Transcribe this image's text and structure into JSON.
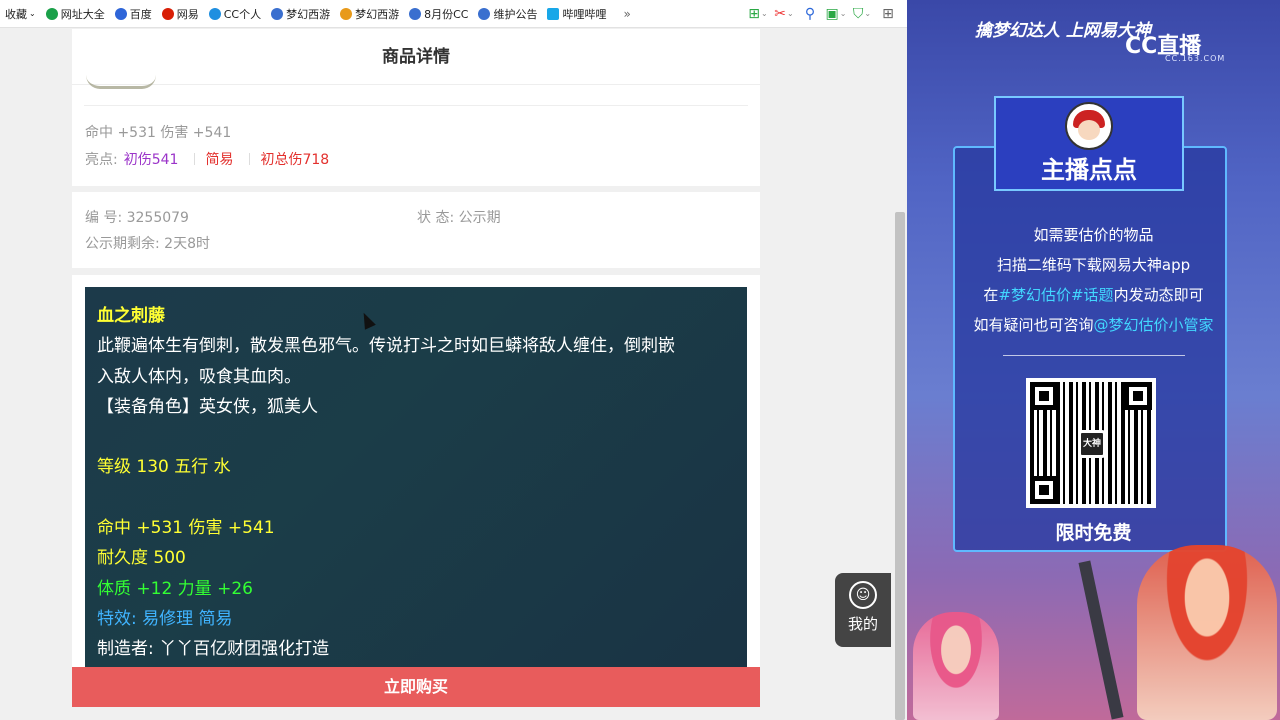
{
  "bookmarks": {
    "items": [
      {
        "label": "收藏",
        "color": "#ffffff"
      },
      {
        "label": "网址大全",
        "color": "#1aa049"
      },
      {
        "label": "百度",
        "color": "#2e65d8"
      },
      {
        "label": "网易",
        "color": "#d81e06"
      },
      {
        "label": "CC个人",
        "color": "#1f8fe0"
      },
      {
        "label": "梦幻西游",
        "color": "#3a6fcf"
      },
      {
        "label": "梦幻西游",
        "color": "#e89a1a"
      },
      {
        "label": "8月份CC",
        "color": "#3a6fcf"
      },
      {
        "label": "维护公告",
        "color": "#3a6fcf"
      },
      {
        "label": "哔哩哔哩",
        "color": "#18a7e8"
      }
    ],
    "more": "»"
  },
  "page": {
    "title": "商品详情",
    "stats": "命中 +531 伤害 +541",
    "highlights_label": "亮点:",
    "highlights": [
      "初伤541",
      "简易",
      "初总伤718"
    ],
    "id_label": "编 号: 3255079",
    "status_label": "状 态: 公示期",
    "remaining": "公示期剩余: 2天8时"
  },
  "item": {
    "name": "血之刺藤",
    "desc1": "此鞭遍体生有倒刺，散发黑色邪气。传说打斗之时如巨蟒将敌人缠住，倒刺嵌",
    "desc2": "入敌人体内，吸食其血肉。",
    "roles": "【装备角色】英女侠，狐美人",
    "level": "等级 130  五行 水",
    "attack": "命中 +531 伤害 +541",
    "durability": "耐久度 500",
    "attrs": "体质 +12 力量 +26",
    "effects": "特效: 易修理 简易",
    "maker": "制造者: 丫丫百亿财团强化打造"
  },
  "buy_button": "立即购买",
  "me_button": "我的",
  "overlay": {
    "slogan": "擒梦幻达人 上网易大神",
    "cc_logo": "CC直播",
    "cc_sub": "CC.163.COM",
    "panel_title": "主播点点",
    "line1": "如需要估价的物品",
    "line2": "扫描二维码下载网易大神app",
    "line3_a": "在",
    "line3_b": "#梦幻估价#话题",
    "line3_c": "内发动态即可",
    "line4_a": "如有疑问也可咨询",
    "line4_b": "@梦幻估价小管家",
    "qr_logo": "大神",
    "free": "限时免费"
  }
}
